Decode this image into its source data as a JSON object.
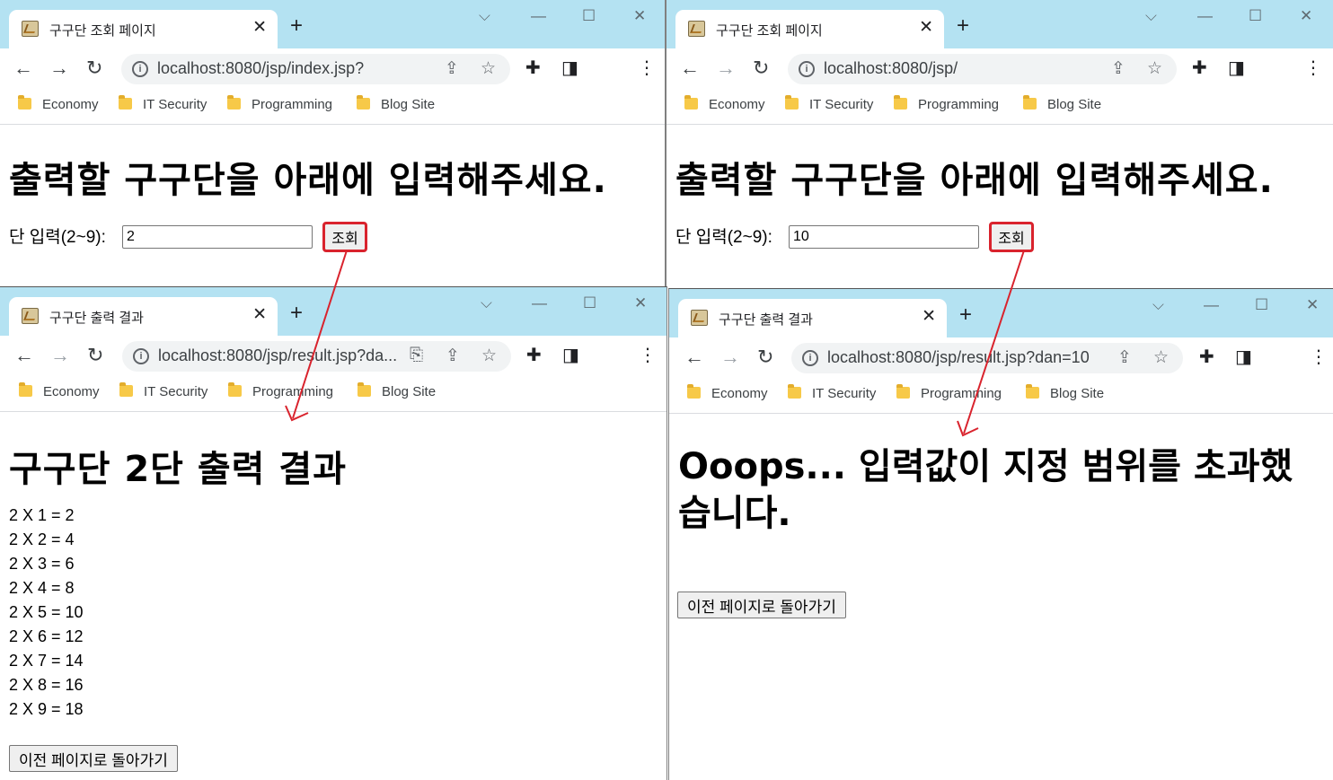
{
  "top_left": {
    "tab_title": "구구단 조회 페이지",
    "url": "localhost:8080/jsp/index.jsp?",
    "bookmarks": [
      "Economy",
      "IT Security",
      "Programming",
      "Blog Site"
    ],
    "heading": "출력할 구구단을 아래에 입력해주세요.",
    "input_label": "단 입력(2~9):",
    "input_value": "2",
    "query_button": "조회"
  },
  "top_right": {
    "tab_title": "구구단 조회 페이지",
    "url": "localhost:8080/jsp/",
    "bookmarks": [
      "Economy",
      "IT Security",
      "Programming",
      "Blog Site"
    ],
    "heading": "출력할 구구단을 아래에 입력해주세요.",
    "input_label": "단 입력(2~9):",
    "input_value": "10",
    "query_button": "조회"
  },
  "bottom_left": {
    "tab_title": "구구단 출력 결과",
    "url": "localhost:8080/jsp/result.jsp?da...",
    "bookmarks": [
      "Economy",
      "IT Security",
      "Programming",
      "Blog Site"
    ],
    "heading": "구구단 2단 출력 결과",
    "results": [
      "2 X 1 = 2",
      "2 X 2 = 4",
      "2 X 3 = 6",
      "2 X 4 = 8",
      "2 X 5 = 10",
      "2 X 6 = 12",
      "2 X 7 = 14",
      "2 X 8 = 16",
      "2 X 9 = 18"
    ],
    "back_button": "이전 페이지로 돌아가기"
  },
  "bottom_right": {
    "tab_title": "구구단 출력 결과",
    "url": "localhost:8080/jsp/result.jsp?dan=10",
    "bookmarks": [
      "Economy",
      "IT Security",
      "Programming",
      "Blog Site"
    ],
    "error_message": "Ooops... 입력값이 지정 범위를 초과했습니다.",
    "back_button": "이전 페이지로 돌아가기"
  },
  "icons": {
    "back": "arrow-left-icon",
    "forward": "arrow-right-icon",
    "reload": "reload-icon",
    "info": "site-info-icon",
    "share": "share-icon",
    "star": "bookmark-star-icon",
    "translate": "translate-icon",
    "extensions": "puzzle-icon",
    "sidepanel": "side-panel-icon",
    "menu": "kebab-menu-icon",
    "folder": "folder-icon",
    "close": "close-icon",
    "newtab": "plus-icon",
    "minimize": "minimize-icon",
    "maximize": "maximize-icon",
    "chevron": "chevron-down-icon"
  },
  "colors": {
    "tabstrip": "#b4e2f2",
    "highlight": "#d9232d",
    "arrow": "#d9232d"
  }
}
